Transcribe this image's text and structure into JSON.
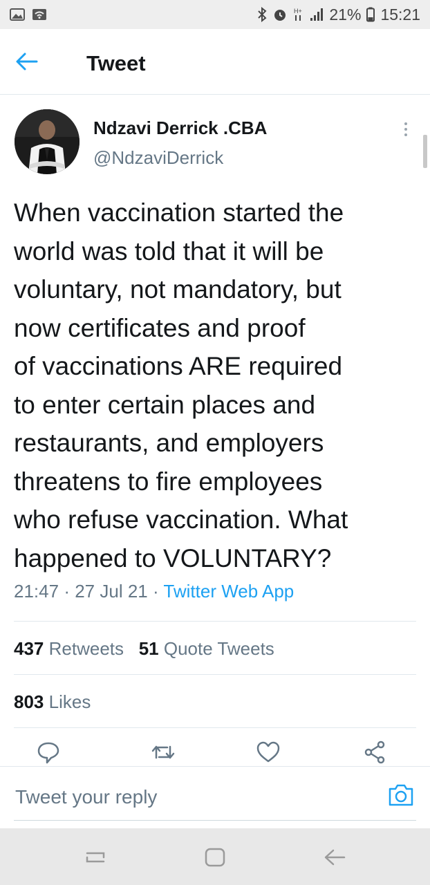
{
  "status_bar": {
    "battery": "21%",
    "time": "15:21",
    "icons": [
      "gallery-icon",
      "wifi-icon",
      "bluetooth-icon",
      "alarm-icon",
      "hplus-icon",
      "signal-icon",
      "battery-icon"
    ]
  },
  "header": {
    "title": "Tweet"
  },
  "tweet": {
    "author_name": "Ndzavi Derrick .CBA",
    "handle": "@NdzaviDerrick",
    "text_lines": [
      "When vaccination started the",
      "world was told that it will be",
      "voluntary, not mandatory, but",
      "now certificates and proof",
      "of vaccinations ARE required",
      "to enter certain places and",
      "restaurants, and employers",
      "threatens to fire employees",
      "who refuse vaccination. What",
      "happened to VOLUNTARY?"
    ],
    "time": "21:47",
    "sep": "·",
    "date": "27 Jul 21",
    "app": "Twitter Web App"
  },
  "stats": {
    "retweets_count": "437",
    "retweets_label": "Retweets",
    "quotes_count": "51",
    "quotes_label": "Quote Tweets",
    "likes_count": "803",
    "likes_label": "Likes"
  },
  "reply": {
    "placeholder": "Tweet your reply"
  },
  "colors": {
    "accent": "#1da1f2",
    "text": "#14171a",
    "muted": "#657786",
    "divider": "#e1e8ed"
  }
}
